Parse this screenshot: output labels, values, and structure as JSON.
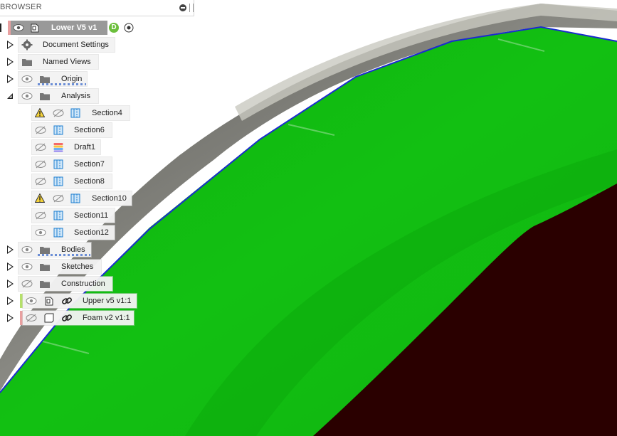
{
  "browser": {
    "title": "BROWSER",
    "root": {
      "label": "Lower V5 v1",
      "badge": "D"
    },
    "items": [
      {
        "label": "Document Settings"
      },
      {
        "label": "Named Views"
      },
      {
        "label": "Origin"
      },
      {
        "label": "Analysis"
      },
      {
        "label": "Bodies"
      },
      {
        "label": "Sketches"
      },
      {
        "label": "Construction"
      },
      {
        "label": "Upper v5 v1:1"
      },
      {
        "label": "Foam v2 v1:1"
      }
    ],
    "analysis_children": [
      {
        "label": "Section4",
        "warning": true
      },
      {
        "label": "Section6",
        "warning": false
      },
      {
        "label": "Draft1",
        "warning": false
      },
      {
        "label": "Section7",
        "warning": false
      },
      {
        "label": "Section8",
        "warning": false
      },
      {
        "label": "Section10",
        "warning": true
      },
      {
        "label": "Section11",
        "warning": false
      },
      {
        "label": "Section12",
        "warning": false
      }
    ]
  },
  "colors": {
    "model_green": "#14c814",
    "shell_grey": "#7a7a72",
    "foam_dark": "#2a0000",
    "edge_blue": "#1a2ad0",
    "upper_bar": "#b5e06a",
    "foam_bar": "#e8a0a0",
    "root_bar": "#e8a0a0"
  }
}
